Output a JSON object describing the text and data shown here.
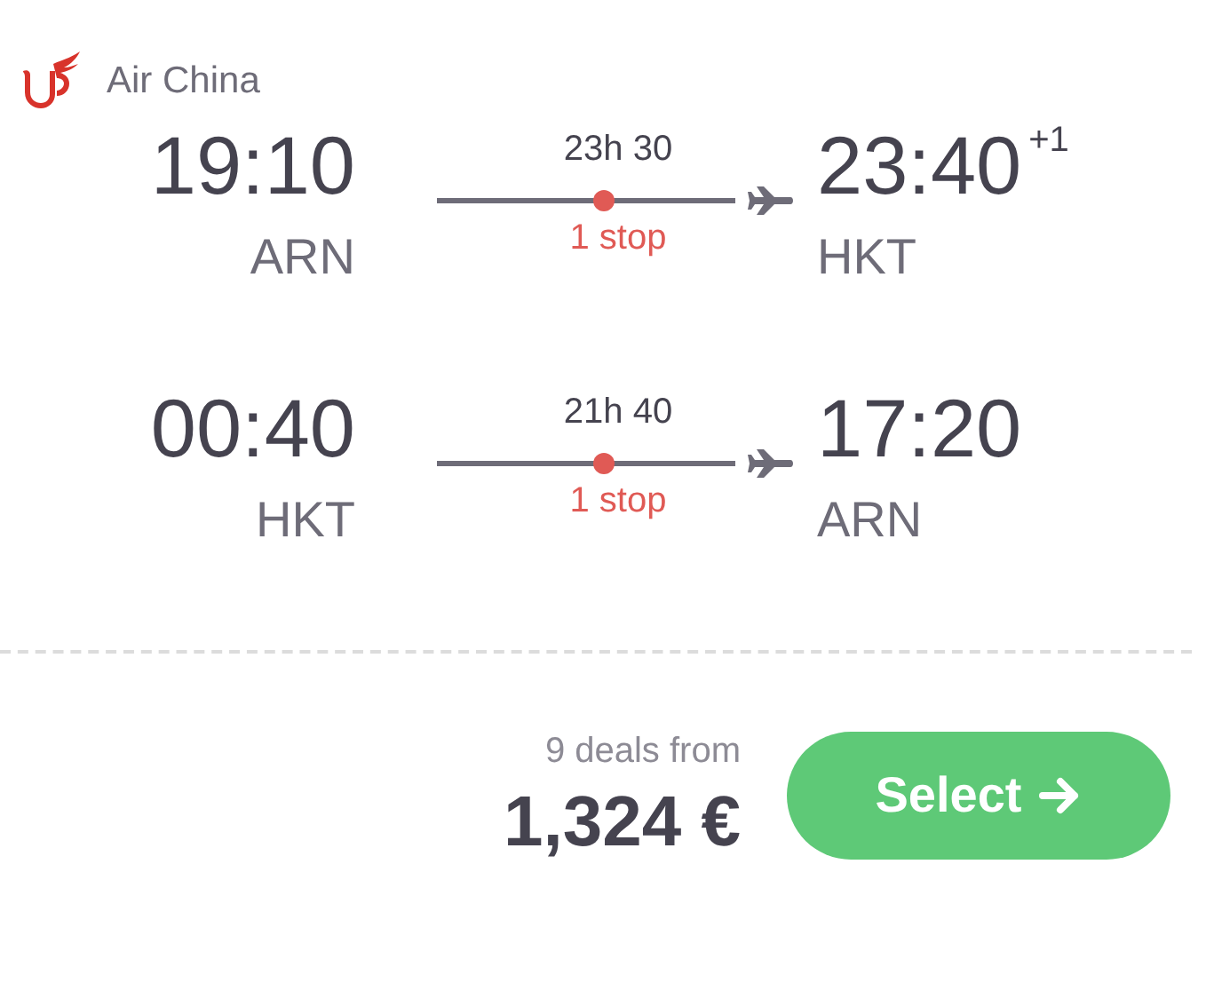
{
  "airline": {
    "name": "Air China"
  },
  "legs": [
    {
      "depart_time": "19:10",
      "depart_airport": "ARN",
      "duration": "23h 30",
      "stops": "1 stop",
      "arrive_time": "23:40",
      "day_offset": "+1",
      "arrive_airport": "HKT"
    },
    {
      "depart_time": "00:40",
      "depart_airport": "HKT",
      "duration": "21h 40",
      "stops": "1 stop",
      "arrive_time": "17:20",
      "arrive_airport": "ARN"
    }
  ],
  "price": {
    "deals": "9 deals from",
    "amount": "1,324 €"
  },
  "select_button": {
    "label": "Select"
  }
}
